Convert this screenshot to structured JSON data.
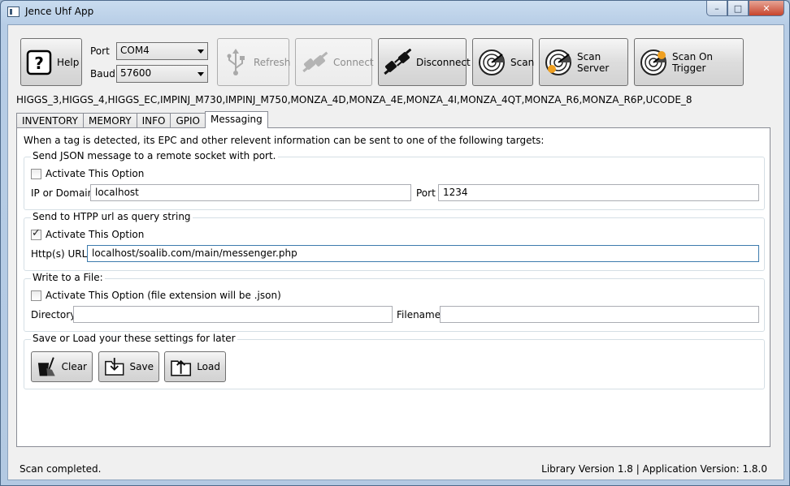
{
  "window": {
    "title": "Jence Uhf App"
  },
  "toolbar": {
    "help_label": "Help",
    "port_label": "Port",
    "port_value": "COM4",
    "baud_label": "Baud",
    "baud_value": "57600",
    "refresh_label": "Refresh",
    "connect_label": "Connect",
    "disconnect_label": "Disconnect",
    "scan_label": "Scan",
    "scan_server_label": "Scan Server",
    "scan_on_trigger_label": "Scan On Trigger"
  },
  "tag_types": "HIGGS_3,HIGGS_4,HIGGS_EC,IMPINJ_M730,IMPINJ_M750,MONZA_4D,MONZA_4E,MONZA_4I,MONZA_4QT,MONZA_R6,MONZA_R6P,UCODE_8",
  "tabs": [
    {
      "label": "INVENTORY"
    },
    {
      "label": "MEMORY"
    },
    {
      "label": "INFO"
    },
    {
      "label": "GPIO"
    },
    {
      "label": "Messaging"
    }
  ],
  "messaging": {
    "intro": "When a tag is detected, its EPC and other relevent information can be sent to one of the following targets:",
    "json_group": {
      "title": "Send JSON message to a remote socket with port.",
      "activate_label": "Activate This Option",
      "activated": false,
      "ip_label": "IP or Domain",
      "ip_value": "localhost",
      "port_label": "Port",
      "port_value": "1234"
    },
    "http_group": {
      "title": "Send to HTPP url as query string",
      "activate_label": "Activate This Option",
      "activated": true,
      "url_label": "Http(s) URL:",
      "url_value": "localhost/soalib.com/main/messenger.php"
    },
    "file_group": {
      "title": "Write to a File:",
      "activate_label": "Activate This Option (file extension will be .json)",
      "activated": false,
      "directory_label": "Directory",
      "directory_value": "",
      "filename_label": "Filename",
      "filename_value": ""
    },
    "settings_group": {
      "title": "Save or Load your these settings for later",
      "clear_label": "Clear",
      "save_label": "Save",
      "load_label": "Load"
    }
  },
  "status": {
    "message": "Scan completed.",
    "version": "Library Version 1.8  | Application Version: 1.8.0"
  }
}
